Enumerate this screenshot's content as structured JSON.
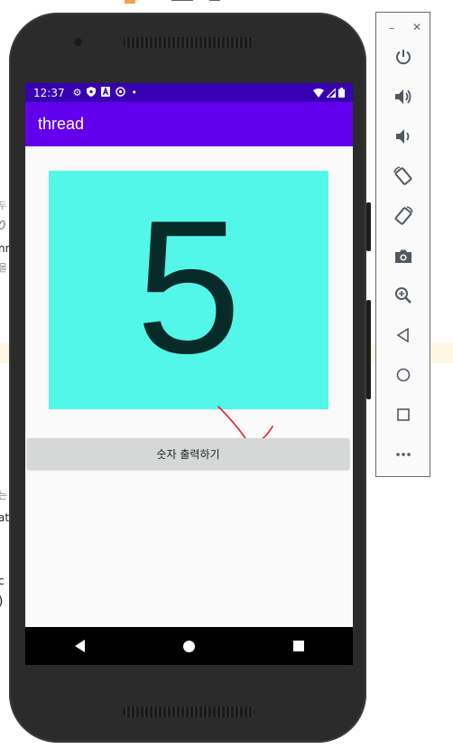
{
  "background_fragments": {
    "line_1": "두",
    "line_2": "0",
    "line_3": "nn",
    "line_4": "을",
    "line_5": "는",
    "line_6": "at",
    "line_7": "c",
    "line_8": ")"
  },
  "status_bar": {
    "time": "12:37",
    "left_icons": [
      "gear-icon",
      "shield-icon",
      "a-icon",
      "at-icon",
      "dot-icon"
    ],
    "right_icons": [
      "wifi-icon",
      "signal-icon",
      "battery-icon"
    ]
  },
  "app_bar": {
    "title": "thread"
  },
  "content": {
    "number_display": "5",
    "number_box_color": "#52f7ea",
    "print_button_label": "숫자 출력하기"
  },
  "nav_bar": {
    "icons": [
      "back-icon",
      "home-icon",
      "recents-icon"
    ]
  },
  "emulator_panel": {
    "window_controls": [
      "minimize-icon",
      "close-icon"
    ],
    "buttons": [
      "power-icon",
      "volume-up-icon",
      "volume-down-icon",
      "rotate-left-icon",
      "rotate-right-icon",
      "camera-icon",
      "zoom-in-icon",
      "back-icon",
      "home-icon",
      "overview-icon",
      "more-icon"
    ]
  },
  "colors": {
    "status_bar": "#3700b3",
    "app_bar": "#6200ee",
    "annotation_stroke": "#e8202a"
  }
}
